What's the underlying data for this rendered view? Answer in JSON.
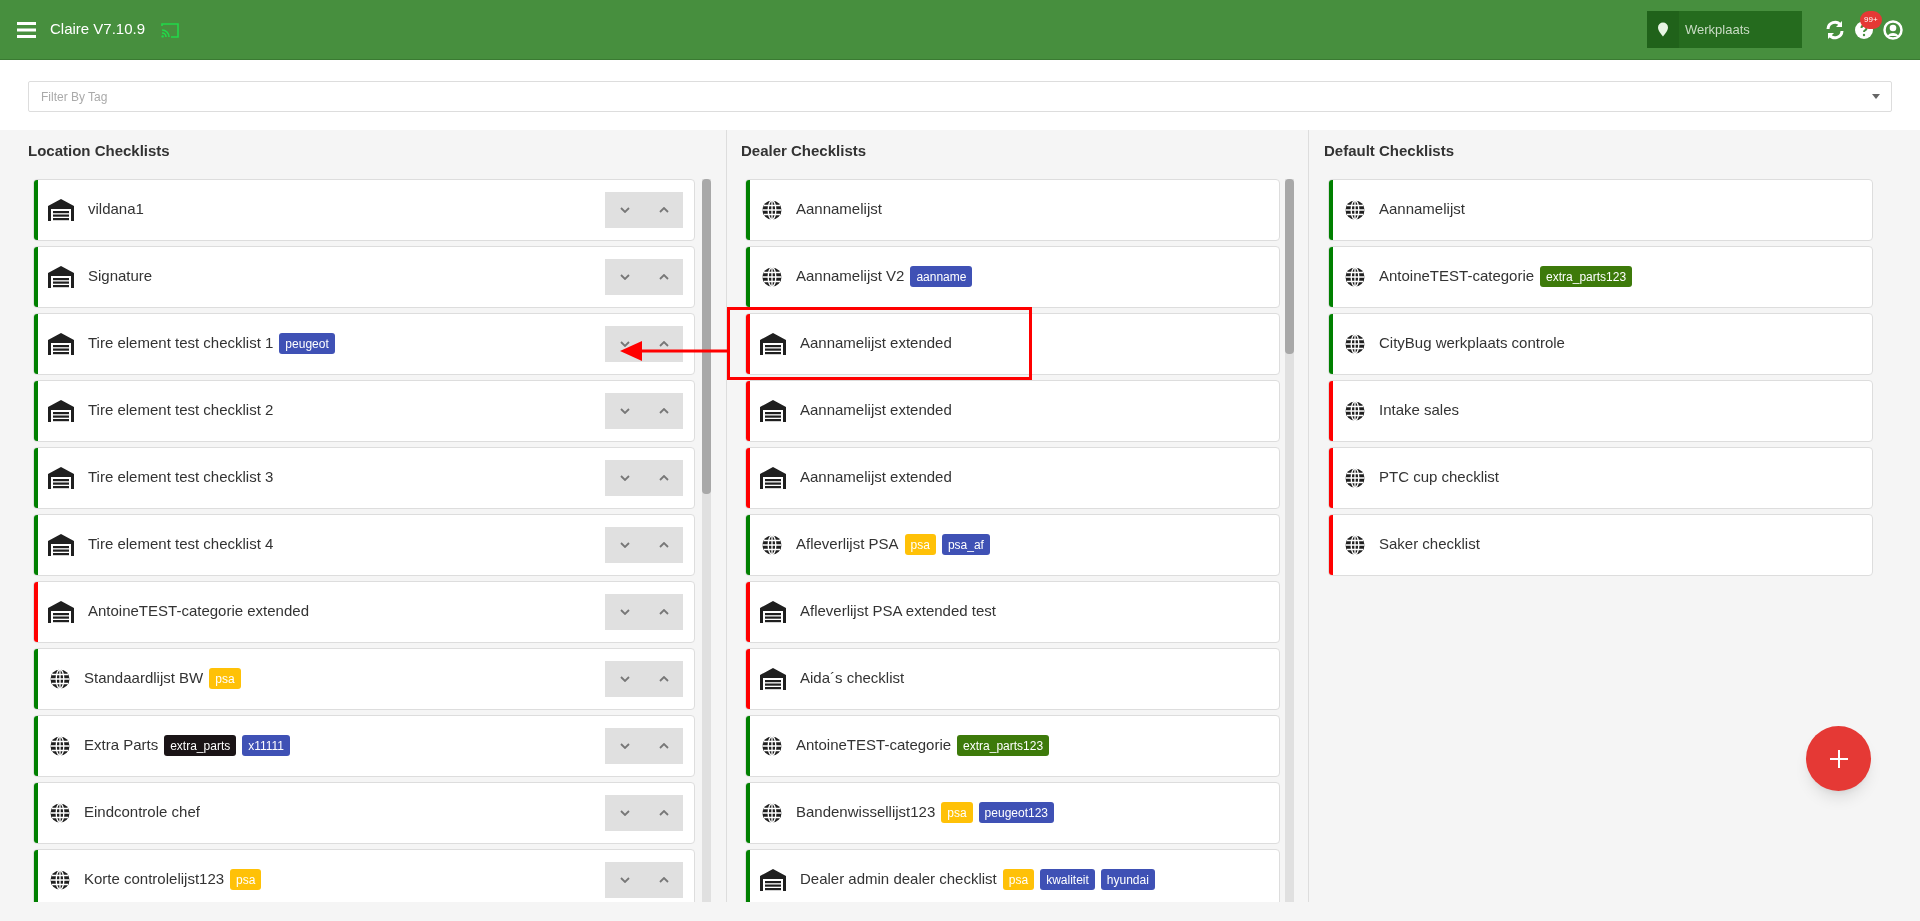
{
  "app_bar": {
    "title": "Claire V7.10.9",
    "location": {
      "placeholder": "Werkplaats"
    },
    "notification_badge": "99+"
  },
  "filter": {
    "placeholder": "Filter By Tag"
  },
  "columns": [
    {
      "title": "Location Checklists",
      "reorderable": true,
      "items": [
        {
          "name": "vildana1",
          "kind": "garage",
          "color": "#008000"
        },
        {
          "name": "Signature",
          "kind": "garage",
          "color": "#008000"
        },
        {
          "name": "Tire element test checklist 1",
          "kind": "garage",
          "color": "#008000",
          "tags": [
            {
              "label": "peugeot",
              "color": "#3f51b5"
            }
          ]
        },
        {
          "name": "Tire element test checklist 2",
          "kind": "garage",
          "color": "#008000"
        },
        {
          "name": "Tire element test checklist 3",
          "kind": "garage",
          "color": "#008000"
        },
        {
          "name": "Tire element test checklist 4",
          "kind": "garage",
          "color": "#008000"
        },
        {
          "name": "AntoineTEST-categorie extended",
          "kind": "garage",
          "color": "#ff0000"
        },
        {
          "name": "Standaardlijst BW",
          "kind": "globe",
          "color": "#008000",
          "tags": [
            {
              "label": "psa",
              "color": "#ffc107"
            }
          ]
        },
        {
          "name": "Extra Parts",
          "kind": "globe",
          "color": "#008000",
          "tags": [
            {
              "label": "extra_parts",
              "color": "#1a1416"
            },
            {
              "label": "x11111",
              "color": "#3f51b5"
            }
          ]
        },
        {
          "name": "Eindcontrole chef",
          "kind": "globe",
          "color": "#008000"
        },
        {
          "name": "Korte controlelijst123",
          "kind": "globe",
          "color": "#008000",
          "tags": [
            {
              "label": "psa",
              "color": "#ffc107"
            }
          ]
        }
      ]
    },
    {
      "title": "Dealer Checklists",
      "reorderable": false,
      "items": [
        {
          "name": "Aannamelijst",
          "kind": "globe",
          "color": "#008000"
        },
        {
          "name": "Aannamelijst V2",
          "kind": "globe",
          "color": "#008000",
          "tags": [
            {
              "label": "aanname",
              "color": "#3f51b5"
            }
          ]
        },
        {
          "name": "Aannamelijst extended",
          "kind": "garage",
          "color": "#ff0000"
        },
        {
          "name": "Aannamelijst extended",
          "kind": "garage",
          "color": "#ff0000"
        },
        {
          "name": "Aannamelijst extended",
          "kind": "garage",
          "color": "#ff0000"
        },
        {
          "name": "Afleverlijst PSA",
          "kind": "globe",
          "color": "#008000",
          "tags": [
            {
              "label": "psa",
              "color": "#ffc107"
            },
            {
              "label": "psa_af",
              "color": "#3f51b5"
            }
          ]
        },
        {
          "name": "Afleverlijst PSA extended test",
          "kind": "garage",
          "color": "#ff0000"
        },
        {
          "name": "Aida´s checklist",
          "kind": "garage",
          "color": "#ff0000"
        },
        {
          "name": "AntoineTEST-categorie",
          "kind": "globe",
          "color": "#008000",
          "tags": [
            {
              "label": "extra_parts123",
              "color": "#3d7a0a"
            }
          ]
        },
        {
          "name": "Bandenwissellijst123",
          "kind": "globe",
          "color": "#008000",
          "tags": [
            {
              "label": "psa",
              "color": "#ffc107"
            },
            {
              "label": "peugeot123",
              "color": "#3f51b5"
            }
          ]
        },
        {
          "name": "Dealer admin dealer checklist",
          "kind": "garage",
          "color": "#008000",
          "tags": [
            {
              "label": "psa",
              "color": "#ffc107"
            },
            {
              "label": "kwaliteit",
              "color": "#3f51b5"
            },
            {
              "label": "hyundai",
              "color": "#3f51b5"
            }
          ]
        }
      ]
    },
    {
      "title": "Default Checklists",
      "reorderable": false,
      "items": [
        {
          "name": "Aannamelijst",
          "kind": "globe",
          "color": "#008000"
        },
        {
          "name": "AntoineTEST-categorie",
          "kind": "globe",
          "color": "#008000",
          "tags": [
            {
              "label": "extra_parts123",
              "color": "#3d7a0a"
            }
          ]
        },
        {
          "name": "CityBug werkplaats controle",
          "kind": "globe",
          "color": "#008000"
        },
        {
          "name": "Intake sales",
          "kind": "globe",
          "color": "#ff0000"
        },
        {
          "name": "PTC cup checklist",
          "kind": "globe",
          "color": "#ff0000"
        },
        {
          "name": "Saker checklist",
          "kind": "globe",
          "color": "#ff0000"
        }
      ]
    }
  ]
}
